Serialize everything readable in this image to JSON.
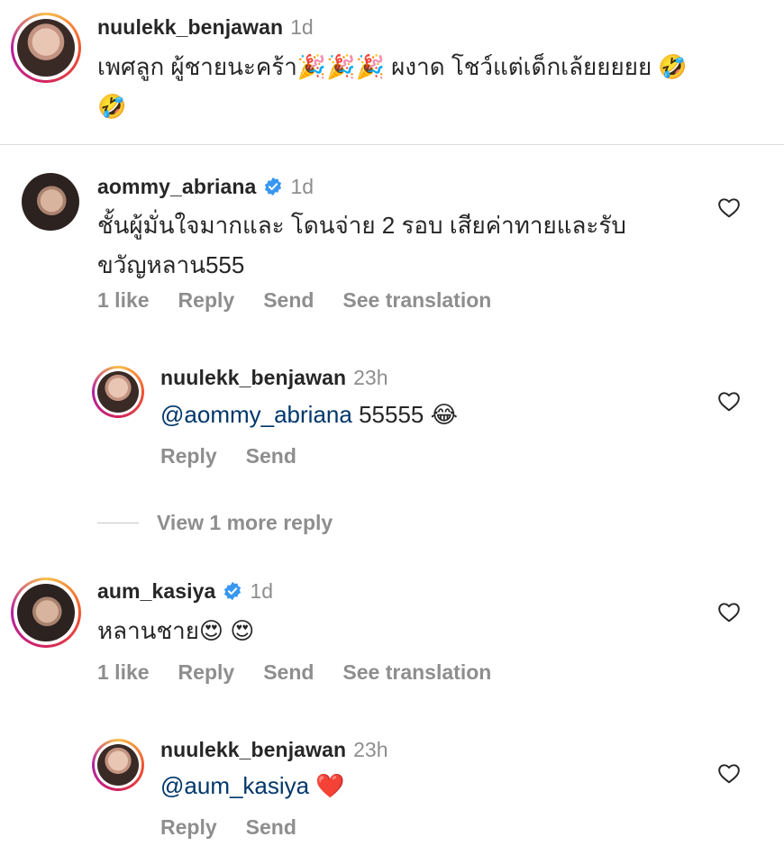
{
  "comments": [
    {
      "username": "nuulekk_benjawan",
      "time": "1d",
      "text_line1": "เพศลูก ผู้ชายนะคร้า🎉🎉🎉 ผงาด โชว์แต่เด็กเล้ยยยยย 🤣",
      "text_line2": "🤣"
    },
    {
      "username": "aommy_abriana",
      "verified": true,
      "time": "1d",
      "text_line1": "ชั้นผู้มั่นใจมากและ โดนจ่าย 2 รอบ เสียค่าทายและรับ",
      "text_line2": "ขวัญหลาน555",
      "actions": {
        "likes": "1 like",
        "reply": "Reply",
        "send": "Send",
        "translate": "See translation"
      },
      "reply": {
        "username": "nuulekk_benjawan",
        "time": "23h",
        "mention": "@aommy_abriana",
        "text": "55555 😂",
        "actions": {
          "reply": "Reply",
          "send": "Send"
        }
      },
      "view_more": "View 1 more reply"
    },
    {
      "username": "aum_kasiya",
      "verified": true,
      "time": "1d",
      "text_line1": "หลานชาย😍 😍",
      "actions": {
        "likes": "1 like",
        "reply": "Reply",
        "send": "Send",
        "translate": "See translation"
      },
      "reply": {
        "username": "nuulekk_benjawan",
        "time": "23h",
        "mention": "@aum_kasiya",
        "text": "❤️",
        "actions": {
          "reply": "Reply",
          "send": "Send"
        }
      }
    }
  ],
  "colors": {
    "text": "#262626",
    "secondary": "#8e8e8e",
    "mention": "#00376b",
    "verified": "#3897f0",
    "divider": "#dbdbdb"
  },
  "icons": [
    "heart-icon",
    "verified-badge-icon"
  ]
}
